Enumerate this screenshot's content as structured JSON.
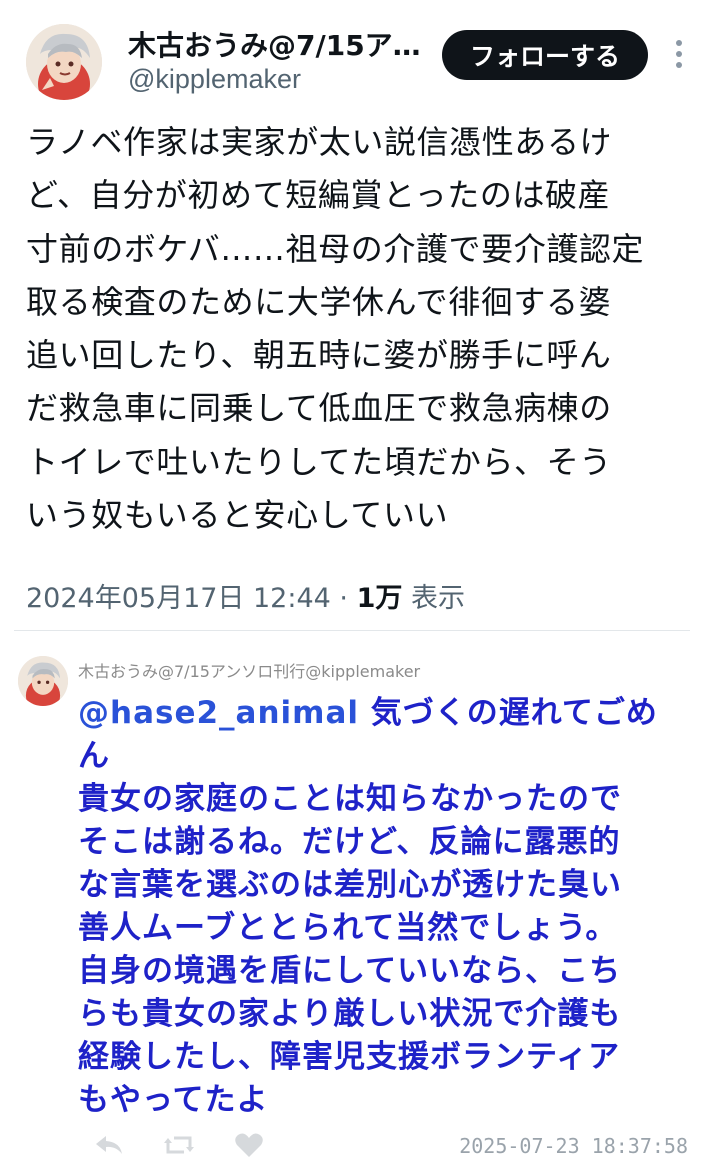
{
  "author": {
    "name": "木古おうみ@7/15ア…",
    "handle": "@kipplemaker"
  },
  "follow_label": "フォローする",
  "tweet": {
    "lines": [
      "ラノベ作家は実家が太い説信憑性あるけ",
      "ど、自分が初めて短編賞とったのは破産",
      "寸前のボケバ……祖母の介護で要介護認定",
      "取る検査のために大学休んで徘徊する婆",
      "追い回したり、朝五時に婆が勝手に呼ん",
      "だ救急車に同乗して低血圧で救急病棟の",
      "トイレで吐いたりしてた頃だから、そう",
      "いう奴もいると安心していい"
    ],
    "timestamp": "2024年05月17日 12:44",
    "separator": "·",
    "views": "1万",
    "views_label": "表示"
  },
  "reply": {
    "header": "木古おうみ@7/15アンソロ刊行@kipplemaker",
    "mention": "@hase2_animal",
    "first_line_rest": " 気づくの遅れてごめ",
    "lines": [
      "ん",
      "貴女の家庭のことは知らなかったので",
      "そこは謝るね。だけど、反論に露悪的",
      "な言葉を選ぶのは差別心が透けた臭い",
      "善人ムーブととられて当然でしょう。",
      "自身の境遇を盾にしていいなら、こち",
      "らも貴女の家より厳しい状況で介護も",
      "経験したし、障害児支援ボランティア",
      "もやってたよ"
    ],
    "timestamp": "2025-07-23 18:37:58"
  },
  "icons": {
    "more": "more-vertical-icon",
    "reply": "reply-icon",
    "retweet": "retweet-icon",
    "like": "heart-icon"
  },
  "colors": {
    "follow_bg": "#0f1419",
    "reply_text": "#1e22c8",
    "mention": "#2a52d8",
    "muted": "#536471"
  }
}
